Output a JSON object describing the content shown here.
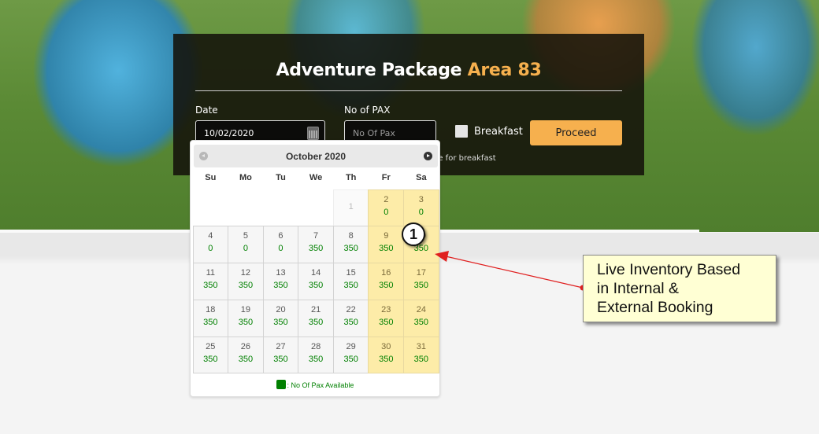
{
  "booking": {
    "title_main": "Adventure Package",
    "title_accent": "Area 83",
    "date_label": "Date",
    "date_value": "10/02/2020",
    "pax_label": "No of PAX",
    "pax_placeholder": "No Of Pax",
    "breakfast_label": "Breakfast",
    "breakfast_checked": false,
    "proceed_label": "Proceed",
    "note_visible": "ge for breakfast"
  },
  "datepicker": {
    "month_title": "October 2020",
    "prev_icon": "prev-circle-arrow",
    "next_icon": "next-circle-arrow",
    "weekdays": [
      "Su",
      "Mo",
      "Tu",
      "We",
      "Th",
      "Fr",
      "Sa"
    ],
    "leading_blank_days": 4,
    "days": [
      {
        "day": "1",
        "avail": "",
        "state": "disabled"
      },
      {
        "day": "2",
        "avail": "0",
        "state": "weekend"
      },
      {
        "day": "3",
        "avail": "0",
        "state": "weekend"
      },
      {
        "day": "4",
        "avail": "0",
        "state": "normal"
      },
      {
        "day": "5",
        "avail": "0",
        "state": "normal"
      },
      {
        "day": "6",
        "avail": "0",
        "state": "normal"
      },
      {
        "day": "7",
        "avail": "350",
        "state": "normal"
      },
      {
        "day": "8",
        "avail": "350",
        "state": "normal"
      },
      {
        "day": "9",
        "avail": "350",
        "state": "weekend"
      },
      {
        "day": "10",
        "avail": "350",
        "state": "weekend"
      },
      {
        "day": "11",
        "avail": "350",
        "state": "normal"
      },
      {
        "day": "12",
        "avail": "350",
        "state": "normal"
      },
      {
        "day": "13",
        "avail": "350",
        "state": "normal"
      },
      {
        "day": "14",
        "avail": "350",
        "state": "normal"
      },
      {
        "day": "15",
        "avail": "350",
        "state": "normal"
      },
      {
        "day": "16",
        "avail": "350",
        "state": "weekend"
      },
      {
        "day": "17",
        "avail": "350",
        "state": "weekend"
      },
      {
        "day": "18",
        "avail": "350",
        "state": "normal"
      },
      {
        "day": "19",
        "avail": "350",
        "state": "normal"
      },
      {
        "day": "20",
        "avail": "350",
        "state": "normal"
      },
      {
        "day": "21",
        "avail": "350",
        "state": "normal"
      },
      {
        "day": "22",
        "avail": "350",
        "state": "normal"
      },
      {
        "day": "23",
        "avail": "350",
        "state": "weekend"
      },
      {
        "day": "24",
        "avail": "350",
        "state": "weekend"
      },
      {
        "day": "25",
        "avail": "350",
        "state": "normal"
      },
      {
        "day": "26",
        "avail": "350",
        "state": "normal"
      },
      {
        "day": "27",
        "avail": "350",
        "state": "normal"
      },
      {
        "day": "28",
        "avail": "350",
        "state": "normal"
      },
      {
        "day": "29",
        "avail": "350",
        "state": "normal"
      },
      {
        "day": "30",
        "avail": "350",
        "state": "weekend"
      },
      {
        "day": "31",
        "avail": "350",
        "state": "weekend"
      }
    ],
    "legend_text": ": No Of Pax Available",
    "legend_color": "#008000"
  },
  "annotation": {
    "marker_number": "1",
    "callout_lines": [
      "Live Inventory Based",
      "in Internal &",
      "External Booking"
    ],
    "arrow_color": "#e02020"
  },
  "colors": {
    "accent": "#f6b04e",
    "available_green": "#008000",
    "weekend_bg": "#fdeca8"
  }
}
